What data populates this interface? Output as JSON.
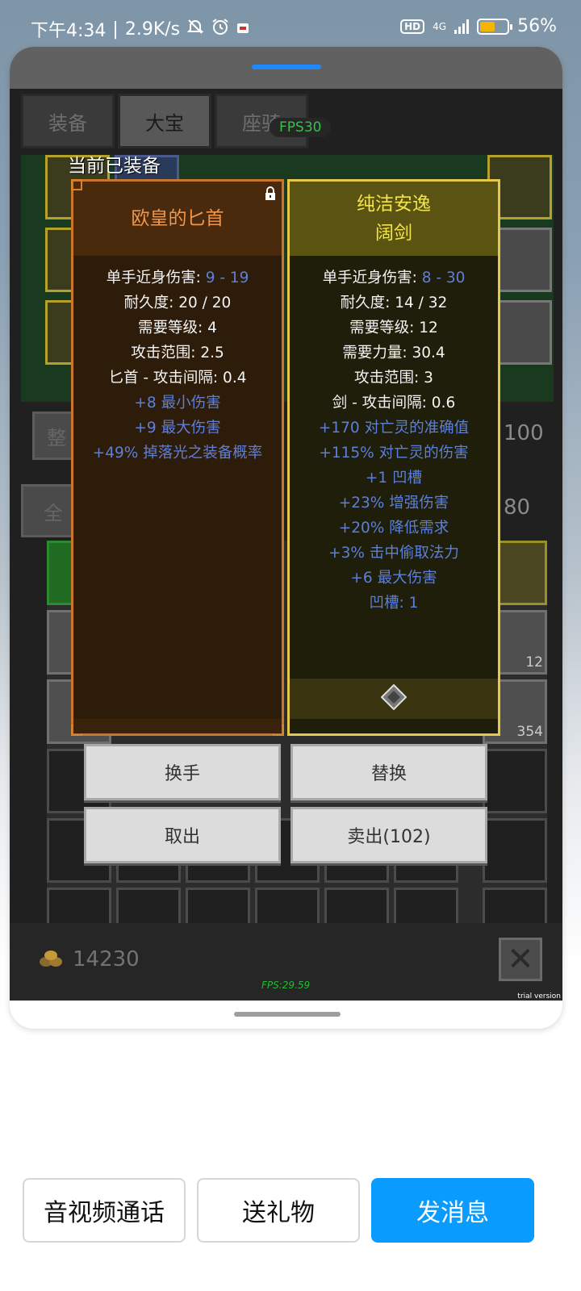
{
  "status_bar": {
    "time": "下午4:34",
    "net_speed": "2.9K/s",
    "battery_percent": "56%",
    "battery_level": 0.56,
    "network": "4G",
    "hd_badge": "HD",
    "icons": [
      "bell-off-icon",
      "alarm-icon",
      "app-notification-icon",
      "signal-icon",
      "battery-icon"
    ]
  },
  "game": {
    "tabs": [
      "装备",
      "大宝",
      "座骑"
    ],
    "active_tab": "大宝",
    "fps_badge": "FPS30",
    "side_left_button": "整",
    "side_right_number": "100",
    "filter_left_button": "全",
    "filter_right_number": "80",
    "inv_counts": [
      "12",
      "354"
    ],
    "gold": "14230",
    "fps_small": "FPS:29.59",
    "trial": "trial version"
  },
  "compare": {
    "equipped_label": "当前已装备",
    "left": {
      "name": "欧皇的匕首",
      "stats": [
        {
          "label": "单手近身伤害: ",
          "value": "9 - 19"
        },
        {
          "label": "耐久度: 20 / 20"
        },
        {
          "label": "需要等级: 4"
        },
        {
          "label": "攻击范围: 2.5"
        },
        {
          "label": "匕首 - 攻击间隔: 0.4"
        }
      ],
      "bonuses": [
        "+8 最小伤害",
        "+9 最大伤害",
        "+49% 掉落光之装备概率"
      ]
    },
    "right": {
      "name_line1": "纯洁安逸",
      "name_line2": "阔剑",
      "stats": [
        {
          "label": "单手近身伤害: ",
          "value": "8 - 30"
        },
        {
          "label": "耐久度: 14 / 32"
        },
        {
          "label": "需要等级: 12"
        },
        {
          "label": "需要力量: 30.4"
        },
        {
          "label": "攻击范围: 3"
        },
        {
          "label": "剑 - 攻击间隔: 0.6"
        }
      ],
      "bonuses": [
        "+170 对亡灵的准确值",
        "+115% 对亡灵的伤害",
        "+1 凹槽",
        "+23% 增强伤害",
        "+20% 降低需求",
        "+3% 击中偷取法力",
        "+6 最大伤害",
        "凹槽: 1"
      ]
    },
    "actions": {
      "swap_hand": "换手",
      "replace": "替换",
      "take_out": "取出",
      "sell": "卖出(102)"
    }
  },
  "bottom_bar": {
    "call": "音视频通话",
    "gift": "送礼物",
    "message": "发消息"
  },
  "colors": {
    "accent_blue": "#0a9bff",
    "left_title": "#f0964a",
    "right_title": "#f2e44a",
    "bonus_blue": "#5d7fd8"
  }
}
